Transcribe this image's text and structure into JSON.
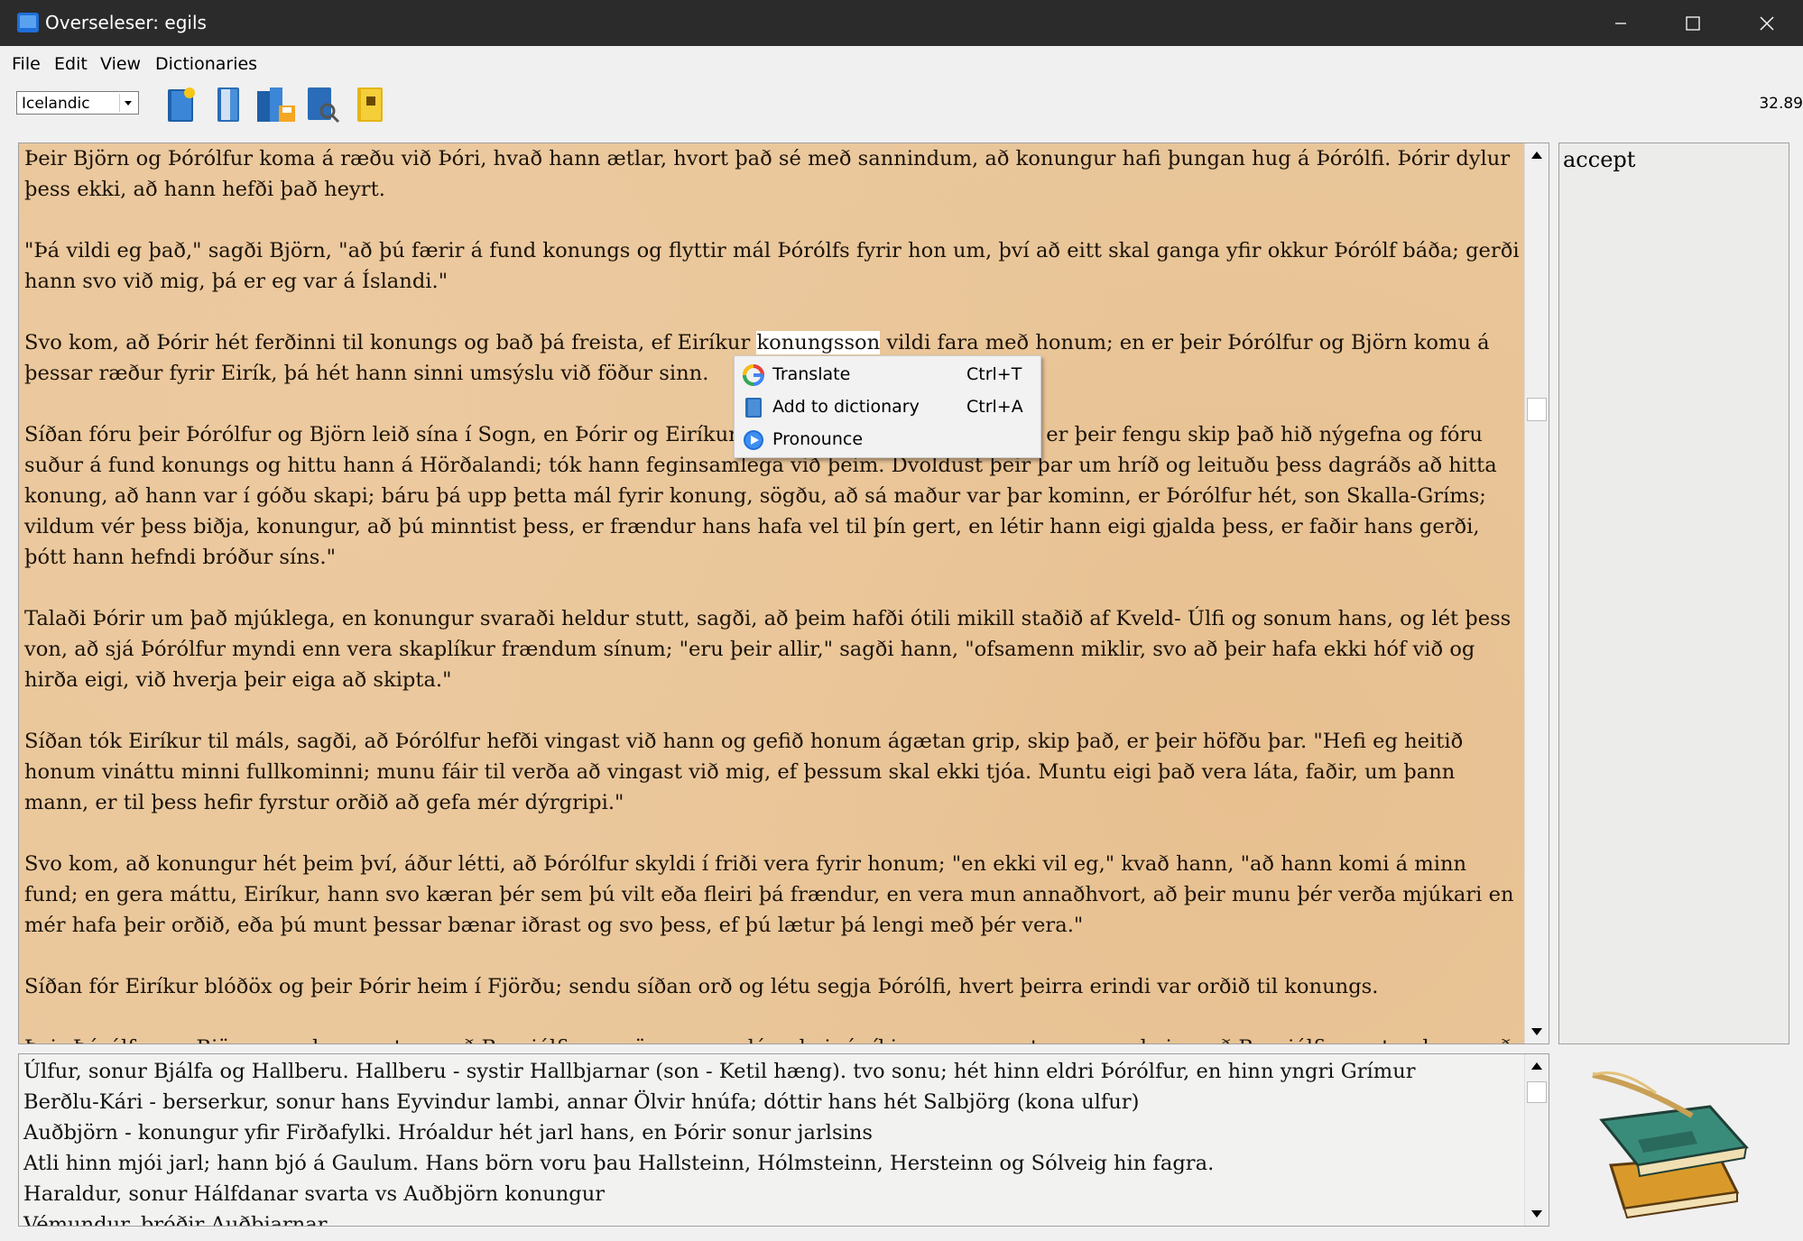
{
  "window": {
    "title": "Overseleser: egils"
  },
  "menubar": {
    "items": [
      "File",
      "Edit",
      "View",
      "Dictionaries"
    ]
  },
  "toolbar": {
    "language_selected": "Icelandic",
    "zoom_readout": "32.89",
    "tools": [
      "new-book-icon",
      "open-book-icon",
      "save-books-icon",
      "search-book-icon",
      "dictionary-book-icon"
    ]
  },
  "text_panel": {
    "paragraphs": [
      "Þeir Björn og Þórólfur koma á ræðu við Þóri, hvað hann ætlar, hvort það sé með sannindum, að konungur hafi þungan hug á Þórólfi. Þórir dylur þess ekki, að hann hefði það heyrt.",
      "\"Þá vildi eg það,\" sagði Björn, \"að þú færir á fund konungs og flyttir mál Þórólfs fyrir hon um, því að eitt skal ganga yfir okkur Þórólf báða; gerði hann svo við mig, þá er eg var á Íslandi.\"",
      {
        "before": "Svo kom, að Þórir hét ferðinni til konungs og bað þá freista, ef Eiríkur ",
        "highlight": "konungsson",
        "after": " vildi fara með honum; en er þeir Þórólfur og Björn komu á þessar ræður fyrir Eirík, þá hét hann sinni umsýslu við föður sinn."
      },
      "Síðan fóru þeir Þórólfur og Björn leið sína í Sogn, en Þórir og Eiríkur konungsson réðust í ferð þá, er þeir fengu skip það hið nýgefna og fóru suður á fund konungs og hittu hann á Hörðalandi; tók hann feginsamlega við þeim. Dvöldust þeir þar um hríð og leituðu þess dagráðs að hitta konung, að hann var í góðu skapi; báru þá upp þetta mál fyrir konung, sögðu, að sá maður var þar kominn, er Þórólfur hét, son Skalla-Gríms; vildum vér þess biðja, konungur, að þú minntist þess, er frændur hans hafa vel til þín gert, en létir hann eigi gjalda þess, er faðir hans gerði, þótt hann hefndi bróður síns.\"",
      "Talaði Þórir um það mjúklega, en konungur svaraði heldur stutt, sagði, að þeim hafði ótili mikill staðið af Kveld- Úlfi og sonum hans, og lét þess von, að sjá Þórólfur myndi enn vera skaplíkur frændum sínum; \"eru þeir allir,\" sagði hann, \"ofsamenn miklir, svo að þeir hafa ekki hóf við og hirða eigi, við hverja þeir eiga að skipta.\"",
      "Síðan tók Eiríkur til máls, sagði, að Þórólfur hefði vingast við hann og gefið honum ágætan grip, skip það, er þeir höfðu þar. \"Hefi eg heitið honum vináttu minni fullkominni; munu fáir til verða að vingast við mig, ef þessum skal ekki tjóa. Muntu eigi það vera láta, faðir, um þann mann, er til þess hefir fyrstur orðið að gefa mér dýrgripi.\"",
      "Svo kom, að konungur hét þeim því, áður létti, að Þórólfur skyldi í friði vera fyrir honum; \"en ekki vil eg,\" kvað hann, \"að hann komi á minn fund; en gera máttu, Eiríkur, hann svo kæran þér sem þú vilt eða fleiri þá frændur, en vera mun annaðhvort, að þeir munu þér verða mjúkari en mér hafa þeir orðið, eða þú munt þessar bænar iðrast og svo þess, ef þú lætur þá lengi með þér vera.\"",
      "Síðan fór Eiríkur blóðöx og þeir Þórir heim í Fjörðu; sendu síðan orð og létu segja Þórólfi, hvert þeirra erindi var orðið til konungs.",
      "Þeir Þórólfur og Björn voru þann vetur með Brynjólfi; en mörg sumur lágu þeir í víking, en um vetrum voru þeir með Brynjólfi, en stundum með Þóri."
    ]
  },
  "word_panel": {
    "word": "accept"
  },
  "notes_panel": {
    "lines": [
      "Úlfur, sonur Bjálfa og Hallberu. Hallberu - systir Hallbjarnar (son - Ketil hæng). tvo sonu; hét hinn eldri Þórólfur, en hinn yngri Grímur",
      "Berðlu-Kári - berserkur, sonur hans Eyvindur lambi, annar Ölvir hnúfa; dóttir hans hét Salbjörg (kona ulfur)",
      "Auðbjörn - konungur yfir Firðafylki. Hróaldur hét jarl hans, en Þórir sonur jarlsins",
      "Atli hinn mjói jarl; hann bjó á Gaulum. Hans börn voru þau Hallsteinn, Hólmsteinn, Hersteinn og Sólveig hin fagra.",
      "Haraldur, sonur Hálfdanar svarta vs Auðbjörn konungur",
      "Vémundur, bróðir Auðbjarnar"
    ]
  },
  "context_menu": {
    "items": [
      {
        "label": "Translate",
        "shortcut": "Ctrl+T",
        "icon": "google-icon"
      },
      {
        "label": "Add to dictionary",
        "shortcut": "Ctrl+A",
        "icon": "dictionary-add-icon"
      },
      {
        "label": "Pronounce",
        "shortcut": "",
        "icon": "play-icon"
      }
    ]
  },
  "colors": {
    "parchment": "#e9c79b",
    "titlebar": "#2b2b2b",
    "menu_bg": "#f2f2f2"
  }
}
